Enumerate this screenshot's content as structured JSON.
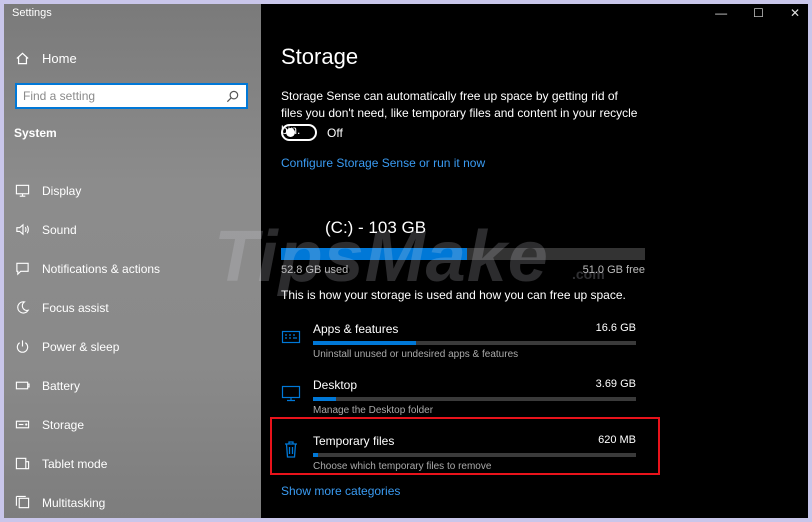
{
  "window": {
    "title": "Settings",
    "controls": [
      "—",
      "☐",
      "✕"
    ]
  },
  "sidebar": {
    "home_label": "Home",
    "home_icon": "home-icon",
    "search": {
      "placeholder": "Find a setting",
      "value": "",
      "icon": "search-icon"
    },
    "section_label": "System",
    "items": [
      {
        "label": "Display",
        "icon": "display-icon"
      },
      {
        "label": "Sound",
        "icon": "sound-icon"
      },
      {
        "label": "Notifications & actions",
        "icon": "notifications-icon"
      },
      {
        "label": "Focus assist",
        "icon": "moon-icon"
      },
      {
        "label": "Power & sleep",
        "icon": "power-icon"
      },
      {
        "label": "Battery",
        "icon": "battery-icon"
      },
      {
        "label": "Storage",
        "icon": "storage-icon"
      },
      {
        "label": "Tablet mode",
        "icon": "tablet-icon"
      },
      {
        "label": "Multitasking",
        "icon": "multitasking-icon"
      }
    ]
  },
  "main": {
    "title": "Storage",
    "storage_sense": {
      "description": "Storage Sense can automatically free up space by getting rid of files you don't need, like temporary files and content in your recycle bin.",
      "toggle_state": "Off",
      "configure_link": "Configure Storage Sense or run it now"
    },
    "drive": {
      "title": "(C:) - 103 GB",
      "used": "52.8 GB used",
      "free": "51.0 GB free",
      "used_fraction": 0.51
    },
    "usage_desc": "This is how your storage is used and how you can free up space.",
    "categories": [
      {
        "name": "Apps & features",
        "size": "16.6 GB",
        "sub": "Uninstall unused or undesired apps & features",
        "icon": "apps-icon",
        "fraction": 0.32
      },
      {
        "name": "Desktop",
        "size": "3.69 GB",
        "sub": "Manage the Desktop folder",
        "icon": "desktop-icon",
        "fraction": 0.07
      },
      {
        "name": "Temporary files",
        "size": "620 MB",
        "sub": "Choose which temporary files to remove",
        "icon": "trash-icon",
        "fraction": 0.015
      }
    ],
    "more_link": "Show more categories"
  },
  "watermark": {
    "text": "TipsMake",
    "domain": ".com"
  },
  "colors": {
    "accent": "#0078d7",
    "link": "#3a9bf2",
    "highlight": "#e8131b",
    "background": "#000000"
  }
}
